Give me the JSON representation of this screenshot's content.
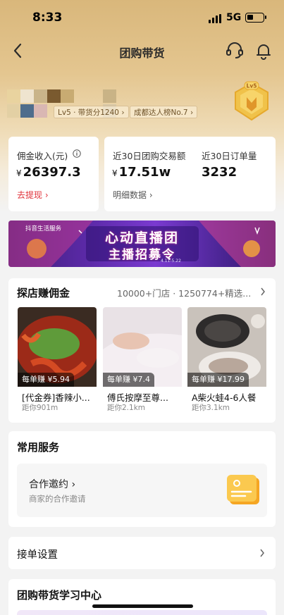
{
  "status_bar": {
    "time": "8:33",
    "network": "5G"
  },
  "nav": {
    "title": "团购带货"
  },
  "profile": {
    "level_chip": "Lv5 · 带货分1240 ›",
    "rank_chip": "成都达人榜No.7 ›",
    "badge_level": "Lv5"
  },
  "stats": {
    "commission_label": "佣金收入(元)",
    "commission_value": "26397.3",
    "currency": "¥",
    "withdraw_link": "去提现 ›",
    "gmv_label": "近30日团购交易额",
    "gmv_value": "17.51w",
    "orders_label": "近30日订单量",
    "orders_value": "3232",
    "details_link": "明细数据 ›"
  },
  "banner": {
    "brand": "抖音生活服务",
    "title": "心动直播团",
    "subtitle": "主播招募令",
    "date": "4.11-5.22"
  },
  "explore": {
    "title": "探店赚佣金",
    "summary": "10000+门店 · 1250774+精选...",
    "items": [
      {
        "earn": "每单赚 ¥5.94",
        "name": "[代金券]香辣小...",
        "distance": "距你901m"
      },
      {
        "earn": "每单赚 ¥7.4",
        "name": "傅氏按摩至尊...",
        "distance": "距你2.1km"
      },
      {
        "earn": "每单赚 ¥17.99",
        "name": "A柴火蛙4-6人餐",
        "distance": "距你3.1km"
      }
    ]
  },
  "services": {
    "title": "常用服务",
    "invite_title": "合作邀约 ›",
    "invite_sub": "商家的合作邀请"
  },
  "order_settings": {
    "label": "接单设置"
  },
  "learning": {
    "title": "团购带货学习中心"
  },
  "colors": {
    "accent_red": "#e0323a",
    "gold": "#d9b77b",
    "banner_purple": "#5c2aa8"
  }
}
